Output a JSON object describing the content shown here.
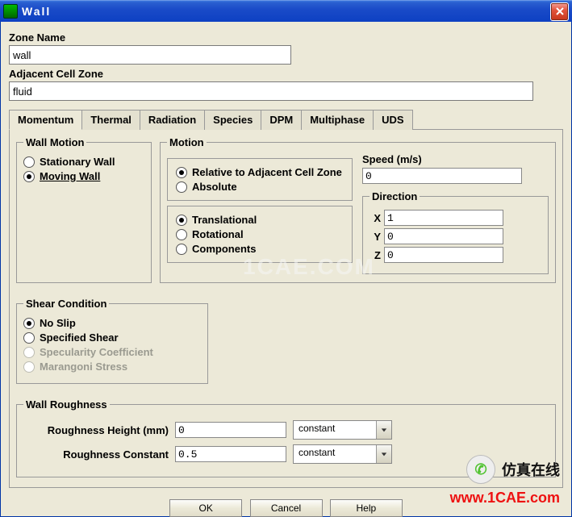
{
  "window": {
    "title": "Wall"
  },
  "zone_name": {
    "label": "Zone Name",
    "value": "wall"
  },
  "adj_zone": {
    "label": "Adjacent Cell Zone",
    "value": "fluid"
  },
  "tabs": {
    "momentum": "Momentum",
    "thermal": "Thermal",
    "radiation": "Radiation",
    "species": "Species",
    "dpm": "DPM",
    "multiphase": "Multiphase",
    "uds": "UDS"
  },
  "wall_motion": {
    "legend": "Wall Motion",
    "stationary": "Stationary Wall",
    "moving": "Moving Wall"
  },
  "motion": {
    "legend": "Motion",
    "relative": "Relative to Adjacent Cell Zone",
    "absolute": "Absolute",
    "translational": "Translational",
    "rotational": "Rotational",
    "components": "Components",
    "speed_label": "Speed (m/s)",
    "speed_value": "0",
    "direction_label": "Direction",
    "x_label": "X",
    "x_value": "1",
    "y_label": "Y",
    "y_value": "0",
    "z_label": "Z",
    "z_value": "0"
  },
  "shear": {
    "legend": "Shear Condition",
    "no_slip": "No Slip",
    "spec_shear": "Specified Shear",
    "specularity": "Specularity Coefficient",
    "marangoni": "Marangoni Stress"
  },
  "roughness": {
    "legend": "Wall Roughness",
    "height_label": "Roughness Height (mm)",
    "height_value": "0",
    "height_dropdown": "constant",
    "constant_label": "Roughness Constant",
    "constant_value": "0.5",
    "constant_dropdown": "constant"
  },
  "buttons": {
    "ok": "OK",
    "cancel": "Cancel",
    "help": "Help"
  },
  "watermarks": {
    "center": "1CAE.COM",
    "brand": "仿真在线",
    "url": "www.1CAE.com"
  }
}
